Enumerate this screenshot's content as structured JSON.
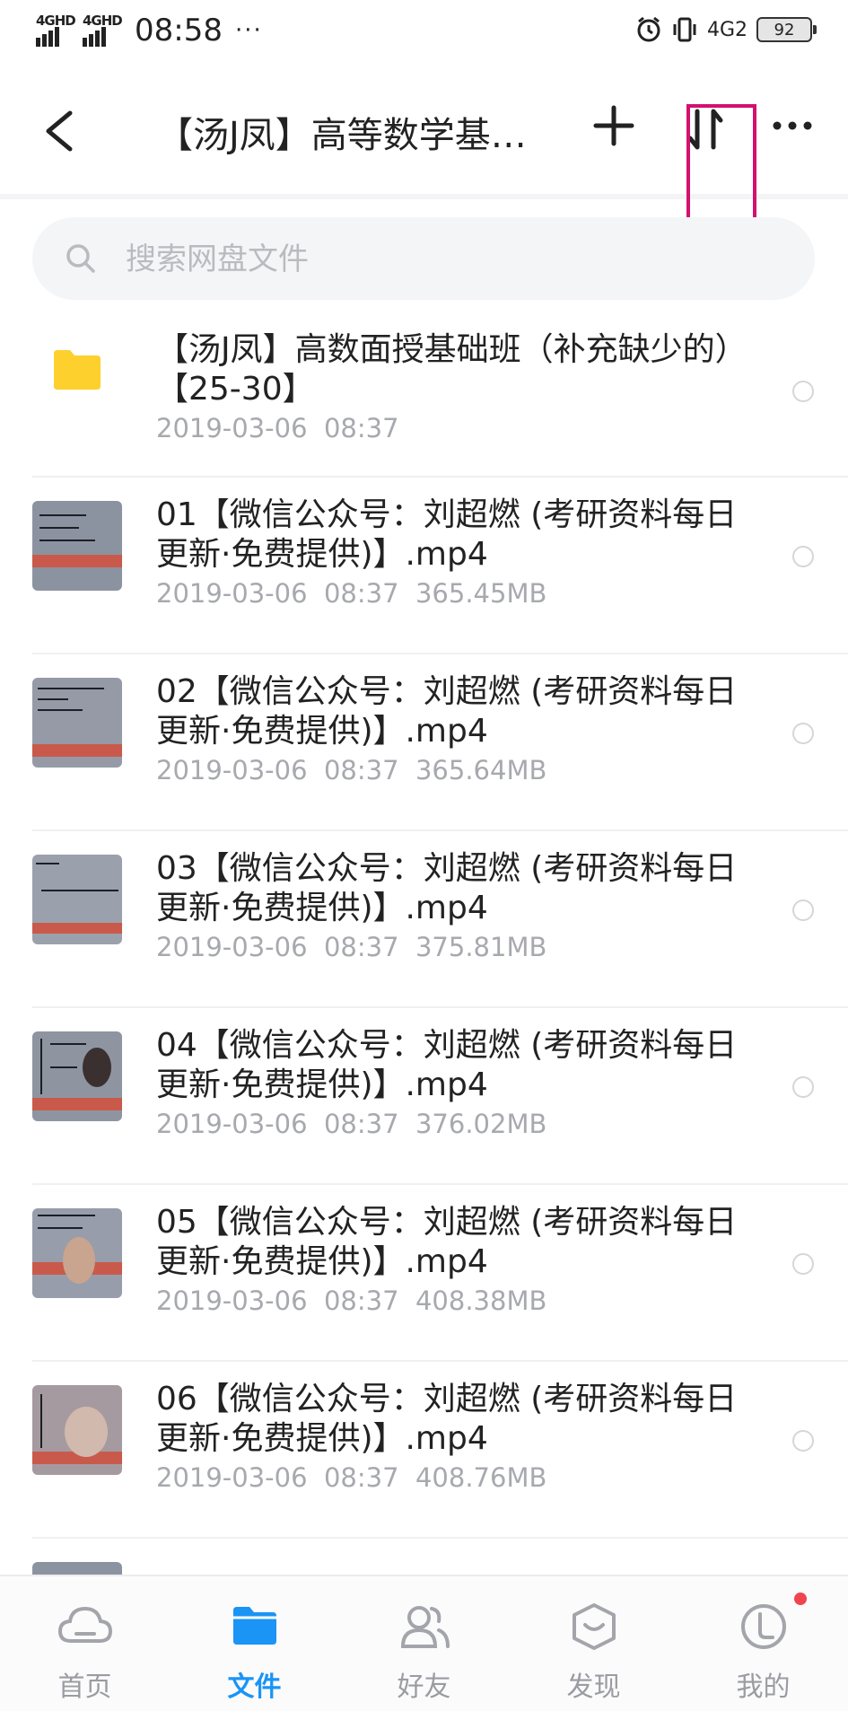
{
  "status_bar": {
    "signal1": "4GHD",
    "signal2": "4GHD",
    "time": "08:58",
    "dots": "···",
    "net": "4G2",
    "battery": "92"
  },
  "header": {
    "title": "【汤J凤】高等数学基…"
  },
  "search": {
    "placeholder": "搜索网盘文件"
  },
  "files": [
    {
      "type": "folder",
      "title": "【汤J凤】高数面授基础班（补充缺少的）【25-30】",
      "date": "2019-03-06  08:37",
      "size": ""
    },
    {
      "type": "video",
      "title": "01【微信公众号：刘超燃 (考研资料每日更新·免费提供)】.mp4",
      "date": "2019-03-06  08:37",
      "size": "365.45MB"
    },
    {
      "type": "video",
      "title": "02【微信公众号：刘超燃 (考研资料每日更新·免费提供)】.mp4",
      "date": "2019-03-06  08:37",
      "size": "365.64MB"
    },
    {
      "type": "video",
      "title": "03【微信公众号：刘超燃 (考研资料每日更新·免费提供)】.mp4",
      "date": "2019-03-06  08:37",
      "size": "375.81MB"
    },
    {
      "type": "video",
      "title": "04【微信公众号：刘超燃 (考研资料每日更新·免费提供)】.mp4",
      "date": "2019-03-06  08:37",
      "size": "376.02MB"
    },
    {
      "type": "video",
      "title": "05【微信公众号：刘超燃 (考研资料每日更新·免费提供)】.mp4",
      "date": "2019-03-06  08:37",
      "size": "408.38MB"
    },
    {
      "type": "video",
      "title": "06【微信公众号：刘超燃 (考研资料每日更新·免费提供)】.mp4",
      "date": "2019-03-06  08:37",
      "size": "408.76MB"
    }
  ],
  "tabs": [
    {
      "label": "首页",
      "icon": "cloud-icon",
      "active": false
    },
    {
      "label": "文件",
      "icon": "folder-icon",
      "active": true
    },
    {
      "label": "好友",
      "icon": "friends-icon",
      "active": false
    },
    {
      "label": "发现",
      "icon": "discover-icon",
      "active": false
    },
    {
      "label": "我的",
      "icon": "profile-icon",
      "active": false
    }
  ],
  "colors": {
    "accent": "#1a94f5",
    "highlight": "#d3116f",
    "folder": "#fdd02d",
    "badge": "#f0454e"
  }
}
